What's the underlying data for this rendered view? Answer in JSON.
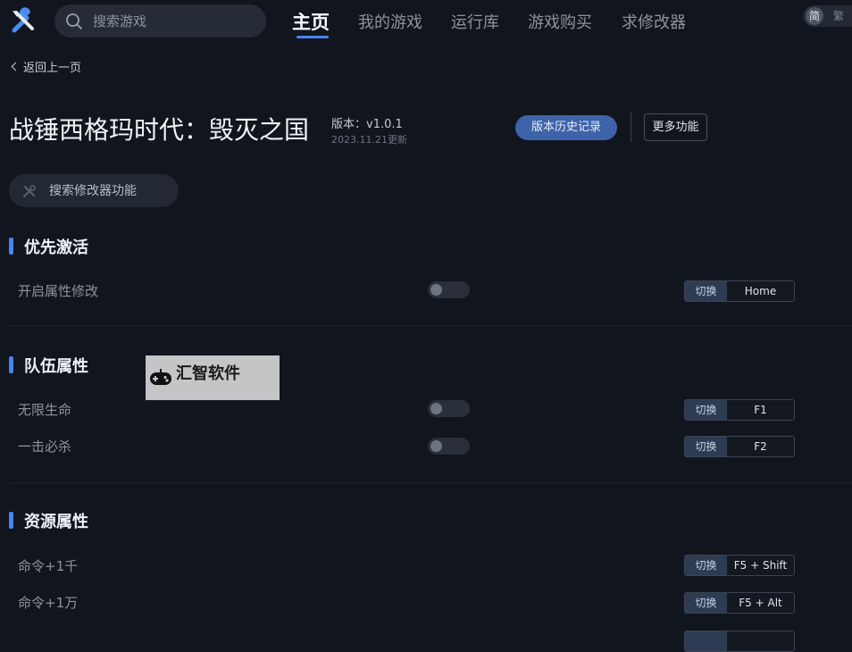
{
  "header": {
    "search_placeholder": "搜索游戏",
    "tabs": [
      {
        "label": "主页",
        "active": true
      },
      {
        "label": "我的游戏",
        "active": false
      },
      {
        "label": "运行库",
        "active": false
      },
      {
        "label": "游戏购买",
        "active": false
      },
      {
        "label": "求修改器",
        "active": false
      }
    ],
    "lang": {
      "simplified": "简",
      "traditional": "繁"
    },
    "accent_color": "#4a84f0"
  },
  "back_label": "返回上一页",
  "game": {
    "title": "战锤西格玛时代：毁灭之国",
    "version": "版本：v1.0.1",
    "updated": "2023.11.21更新",
    "history_button": "版本历史记录",
    "more_button": "更多功能"
  },
  "feature_search_placeholder": "搜索修改器功能",
  "watermark": {
    "text": "汇智软件"
  },
  "sections": [
    {
      "title": "优先激活",
      "rows": [
        {
          "label": "开启属性修改",
          "toggle_on": false,
          "action": "切换",
          "key": "Home"
        }
      ]
    },
    {
      "title": "队伍属性",
      "rows": [
        {
          "label": "无限生命",
          "toggle_on": false,
          "action": "切换",
          "key": "F1"
        },
        {
          "label": "一击必杀",
          "toggle_on": false,
          "action": "切换",
          "key": "F2"
        }
      ]
    },
    {
      "title": "资源属性",
      "rows": [
        {
          "label": "命令+1千",
          "action": "切换",
          "key": "F5 + Shift"
        },
        {
          "label": "命令+1万",
          "action": "切换",
          "key": "F5 + Alt"
        }
      ]
    }
  ]
}
